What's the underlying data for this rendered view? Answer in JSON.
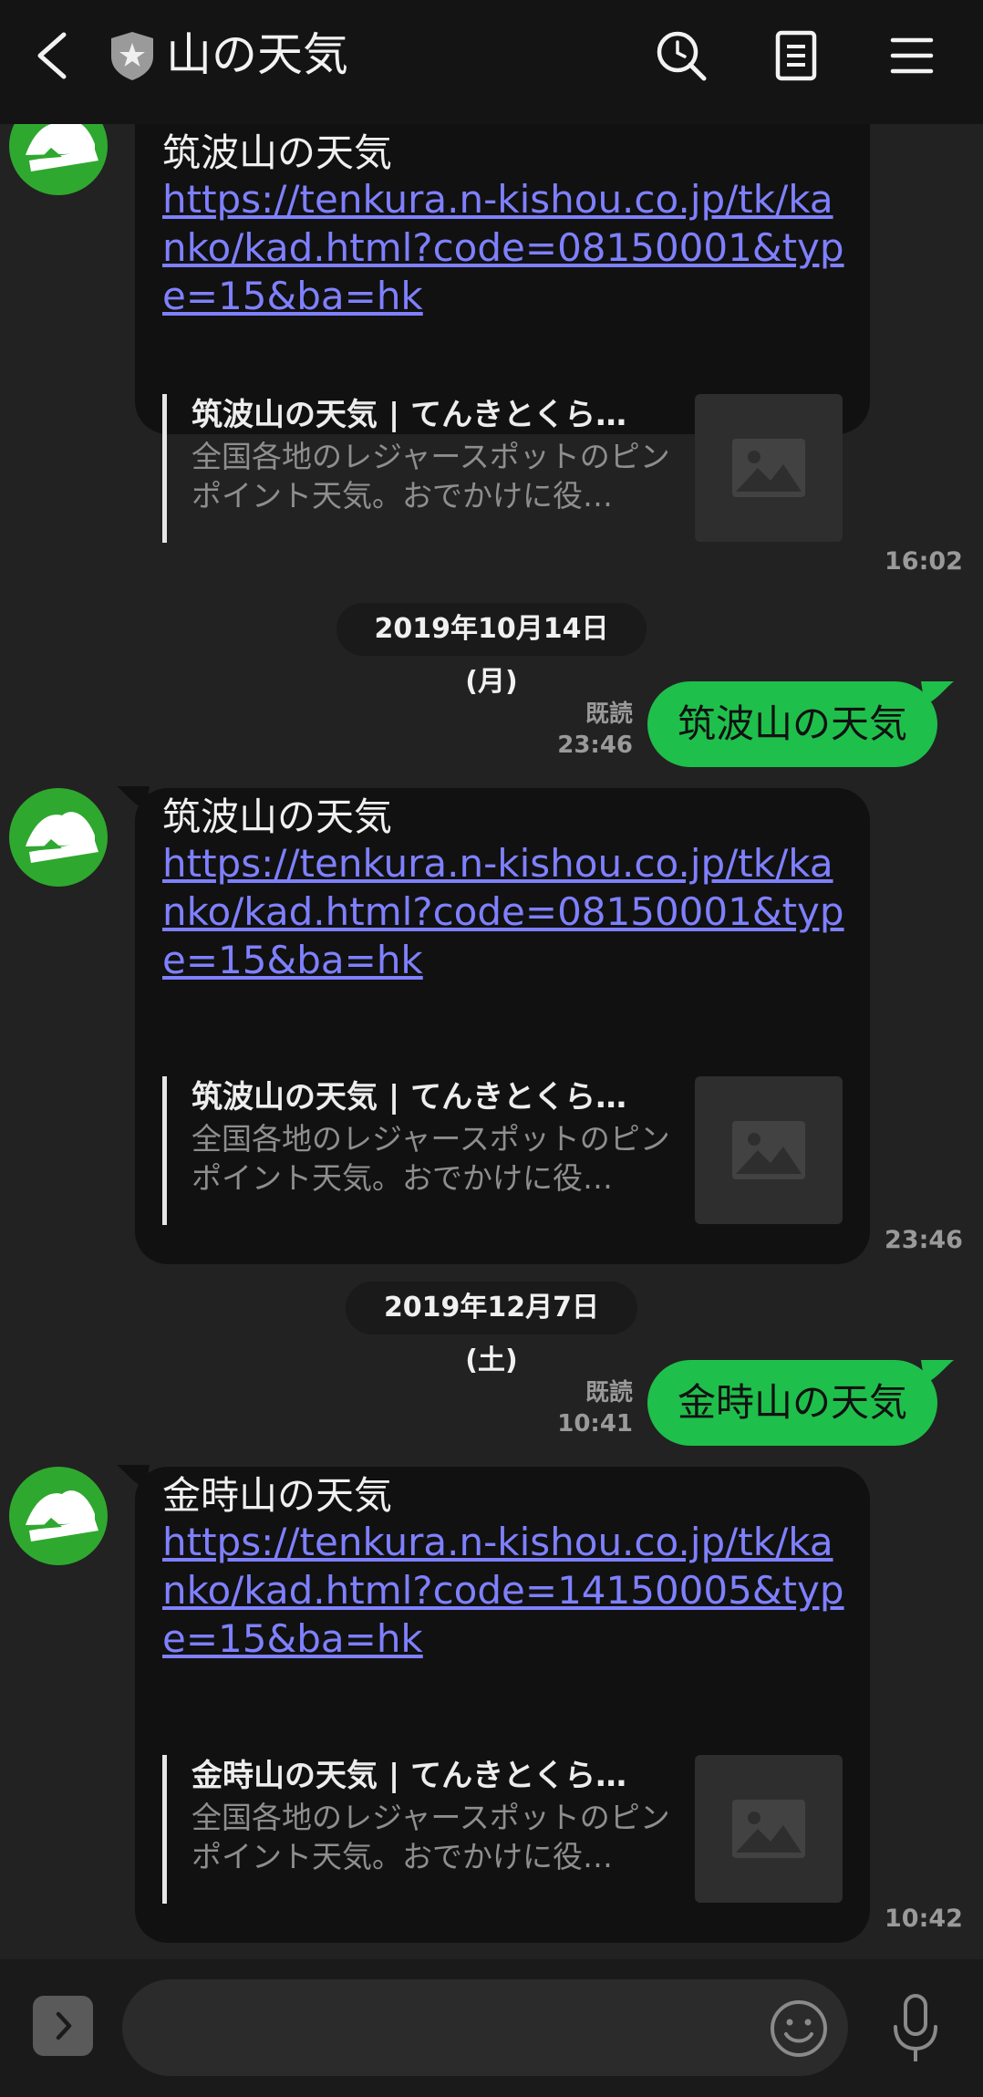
{
  "header": {
    "title": "山の天気"
  },
  "messages": [
    {
      "title": "筑波山の天気",
      "link": "https://tenkura.n-kishou.co.jp/tk/kanko/kad.html?code=08150001&type=15&ba=hk",
      "preview_title": "筑波山の天気 | てんきとくら…",
      "preview_desc": "全国各地のレジャースポットのピンポイント天気。おでかけに役…",
      "time": "16:02"
    },
    {
      "title": "筑波山の天気",
      "link": "https://tenkura.n-kishou.co.jp/tk/kanko/kad.html?code=08150001&type=15&ba=hk",
      "preview_title": "筑波山の天気 | てんきとくら…",
      "preview_desc": "全国各地のレジャースポットのピンポイント天気。おでかけに役…",
      "time": "23:46"
    },
    {
      "title": "金時山の天気",
      "link": "https://tenkura.n-kishou.co.jp/tk/kanko/kad.html?code=14150005&type=15&ba=hk",
      "preview_title": "金時山の天気 | てんきとくら…",
      "preview_desc": "全国各地のレジャースポットのピンポイント天気。おでかけに役…",
      "time": "10:42"
    }
  ],
  "dates": [
    "2019年10月14日(月)",
    "2019年12月7日(土)"
  ],
  "sent": [
    {
      "text": "筑波山の天気",
      "read": "既読",
      "time": "23:46"
    },
    {
      "text": "金時山の天気",
      "read": "既読",
      "time": "10:41"
    }
  ],
  "colors": {
    "accent_green": "#1fbf4b",
    "link": "#7f80ff",
    "avatar": "#2fa82f"
  },
  "icons": [
    "back-icon",
    "shield-star-icon",
    "search-icon",
    "notes-icon",
    "menu-icon",
    "expand-icon",
    "emoji-icon",
    "mic-icon",
    "image-placeholder-icon"
  ]
}
